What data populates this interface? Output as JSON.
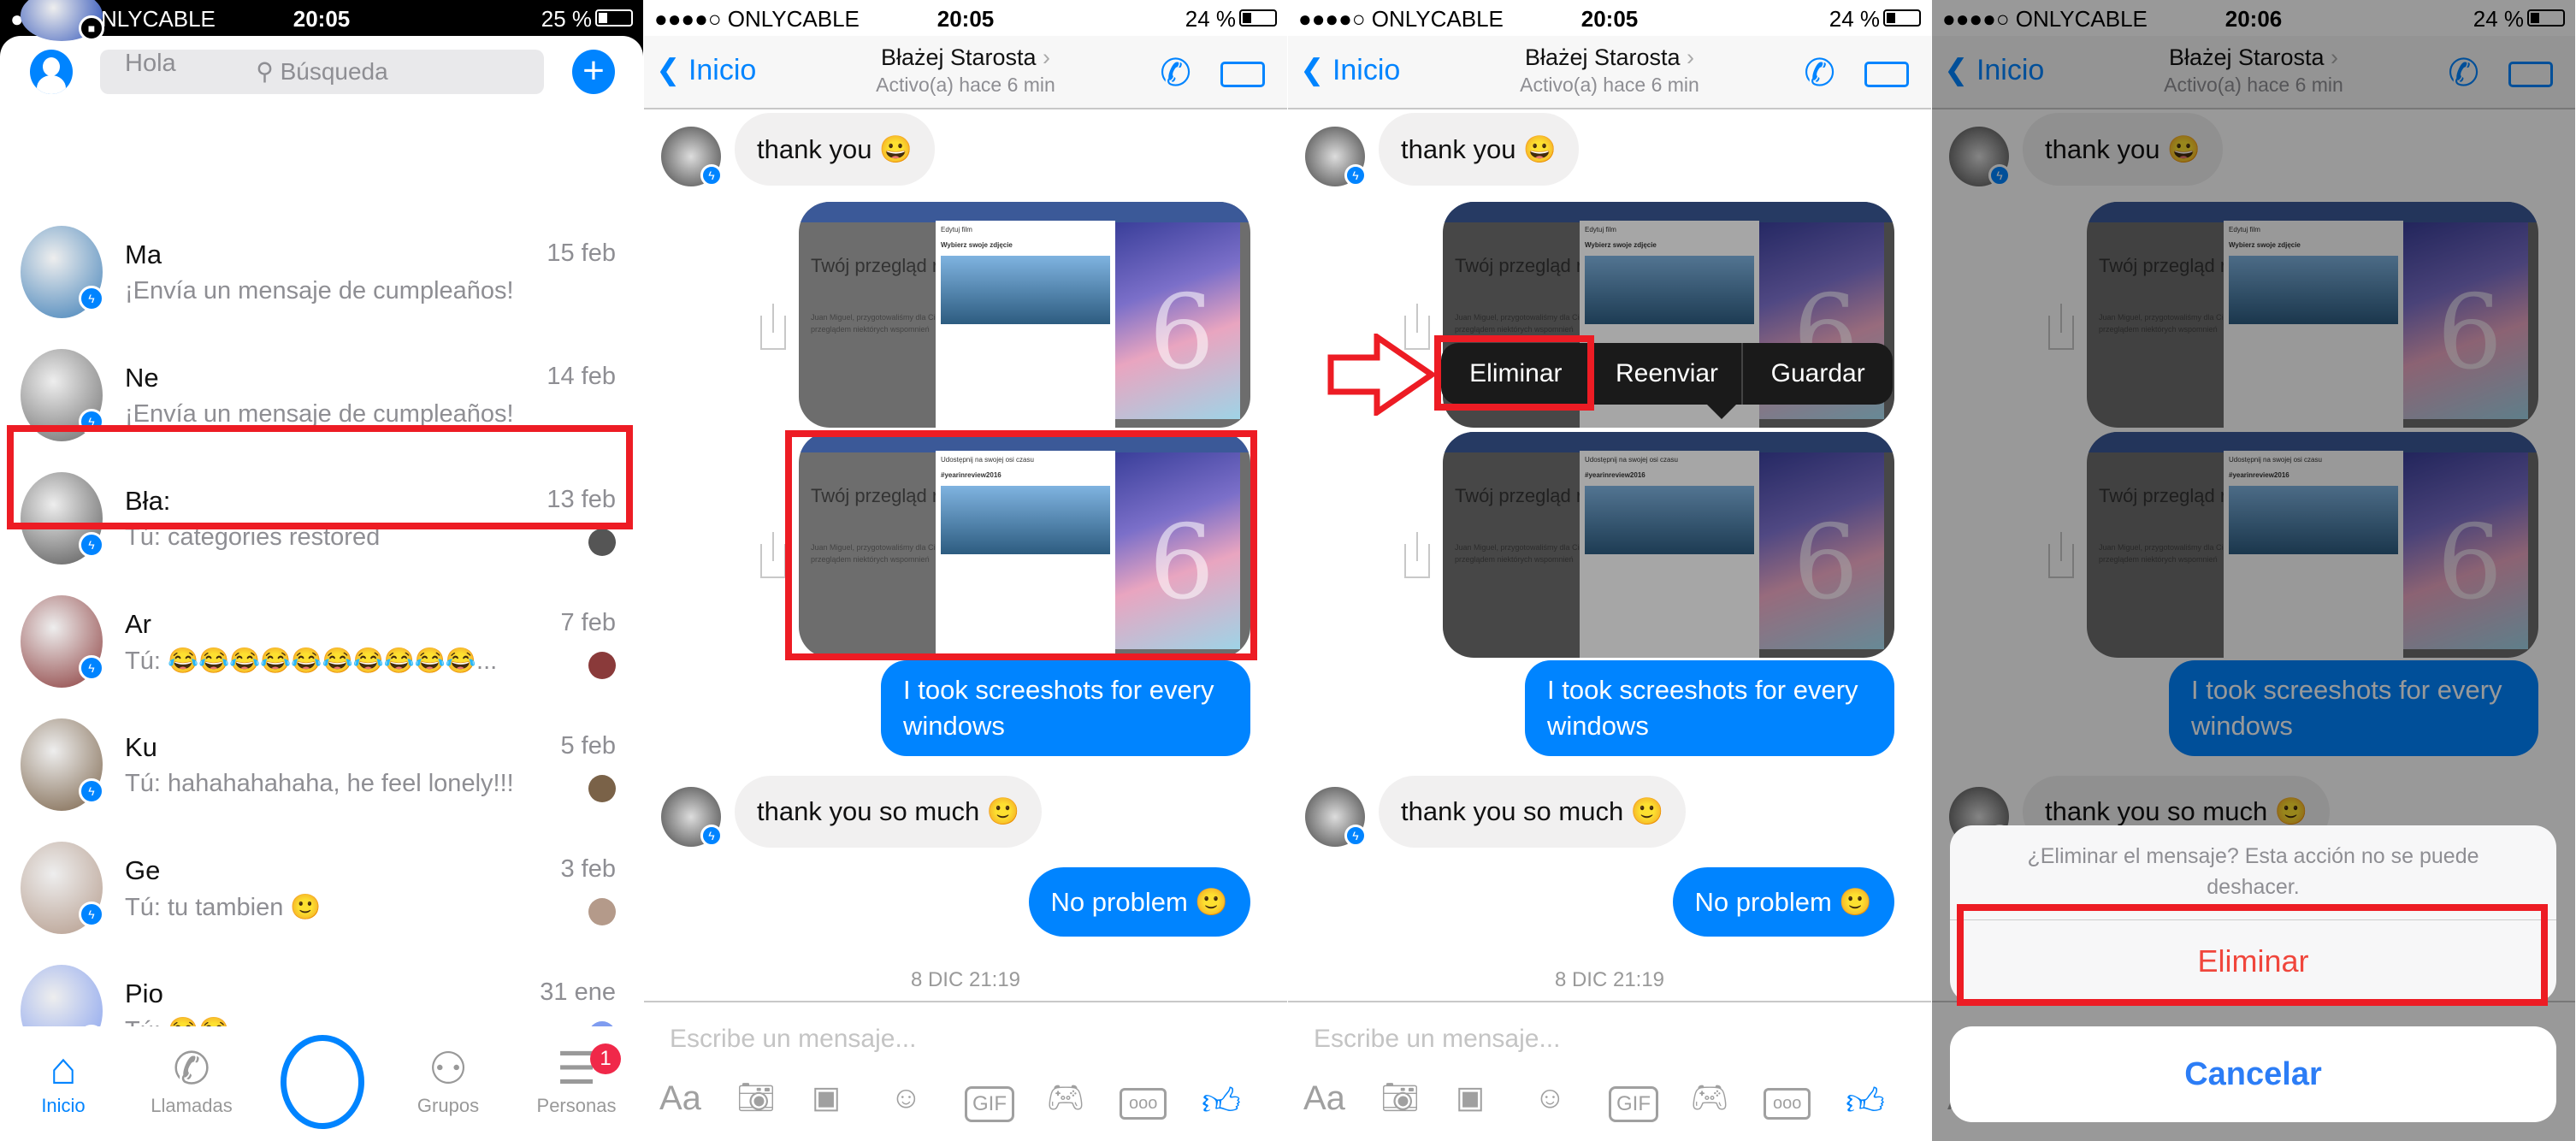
{
  "inbox": {
    "status": {
      "carrier": "●●●●○ ONLYCABLE",
      "time": "20:05",
      "battery": "25 %"
    },
    "search_placeholder": "Búsqueda",
    "conversations": [
      {
        "name": "",
        "preview": "Hola",
        "date": "",
        "badge": "lock-icon",
        "color": "#2a4fb8"
      },
      {
        "name": "Ma",
        "preview": "¡Envía un mensaje de cumpleaños!",
        "date": "15 feb",
        "badge": "messenger-icon",
        "color": "#3e7fb8"
      },
      {
        "name": "Ne",
        "preview": "¡Envía un mensaje de cumpleaños!",
        "date": "14 feb",
        "badge": "messenger-icon",
        "color": "#6b6b6b"
      },
      {
        "name": "Bła:",
        "preview": "Tú: categories restored",
        "date": "13 feb",
        "badge": "messenger-icon",
        "color": "#555555"
      },
      {
        "name": "Ar",
        "preview": "Tú: 😂😂😂😂😂😂😂😂😂😂...",
        "date": "7 feb",
        "badge": "messenger-icon",
        "color": "#8a3a3a"
      },
      {
        "name": "Ku",
        "preview": "Tú: hahahahahaha, he feel lonely!!!",
        "date": "5 feb",
        "badge": "messenger-icon",
        "color": "#7a6248"
      },
      {
        "name": "Ge",
        "preview": "Tú: tu tambien 🙂",
        "date": "3 feb",
        "badge": "messenger-icon",
        "color": "#b49a8a"
      },
      {
        "name": "Pio",
        "preview": "Tú: 😂😂",
        "date": "31 ene",
        "badge": "facebook-icon",
        "color": "#7f9cf0"
      }
    ],
    "tabs": [
      {
        "label": "Inicio",
        "active": true
      },
      {
        "label": "Llamadas"
      },
      {
        "label": ""
      },
      {
        "label": "Grupos"
      },
      {
        "label": "Personas",
        "badge": "1"
      }
    ]
  },
  "chats": [
    {
      "status": {
        "carrier": "●●●●○ ONLYCABLE",
        "time": "20:05",
        "battery": "24 %"
      }
    },
    {
      "status": {
        "carrier": "●●●●○ ONLYCABLE",
        "time": "20:05",
        "battery": "24 %"
      },
      "menu": [
        "Eliminar",
        "Reenviar",
        "Guardar"
      ]
    },
    {
      "status": {
        "carrier": "●●●●○ ONLYCABLE",
        "time": "20:06",
        "battery": "24 %"
      },
      "sheet": {
        "message": "¿Eliminar el mensaje? Esta acción no se puede deshacer.",
        "destructive": "Eliminar",
        "cancel": "Cancelar"
      }
    }
  ],
  "conversation": {
    "back": "Inicio",
    "contact": "Błażej Starosta",
    "activity": "Activo(a) hace 6 min",
    "messages": [
      "thank you 😀",
      "I took screeshots for every windows",
      "thank you so much 🙂",
      "No problem 🙂"
    ],
    "thumb_title": "Twój przegląd ro",
    "thumb_dialogs": [
      "Edytuj film",
      "Udostępnij na swojej osi czasu"
    ],
    "thumb_sub": [
      "Wybierz swoje zdjęcie",
      "#yearinreview2016"
    ],
    "date": "8 DIC 21:19",
    "input_placeholder": "Escribe un mensaje...",
    "tools": [
      "Aa",
      "GIF"
    ]
  },
  "colors": {
    "accent": "#0084ff",
    "highlight": "#ed1c24",
    "destructive": "#f0463c"
  }
}
